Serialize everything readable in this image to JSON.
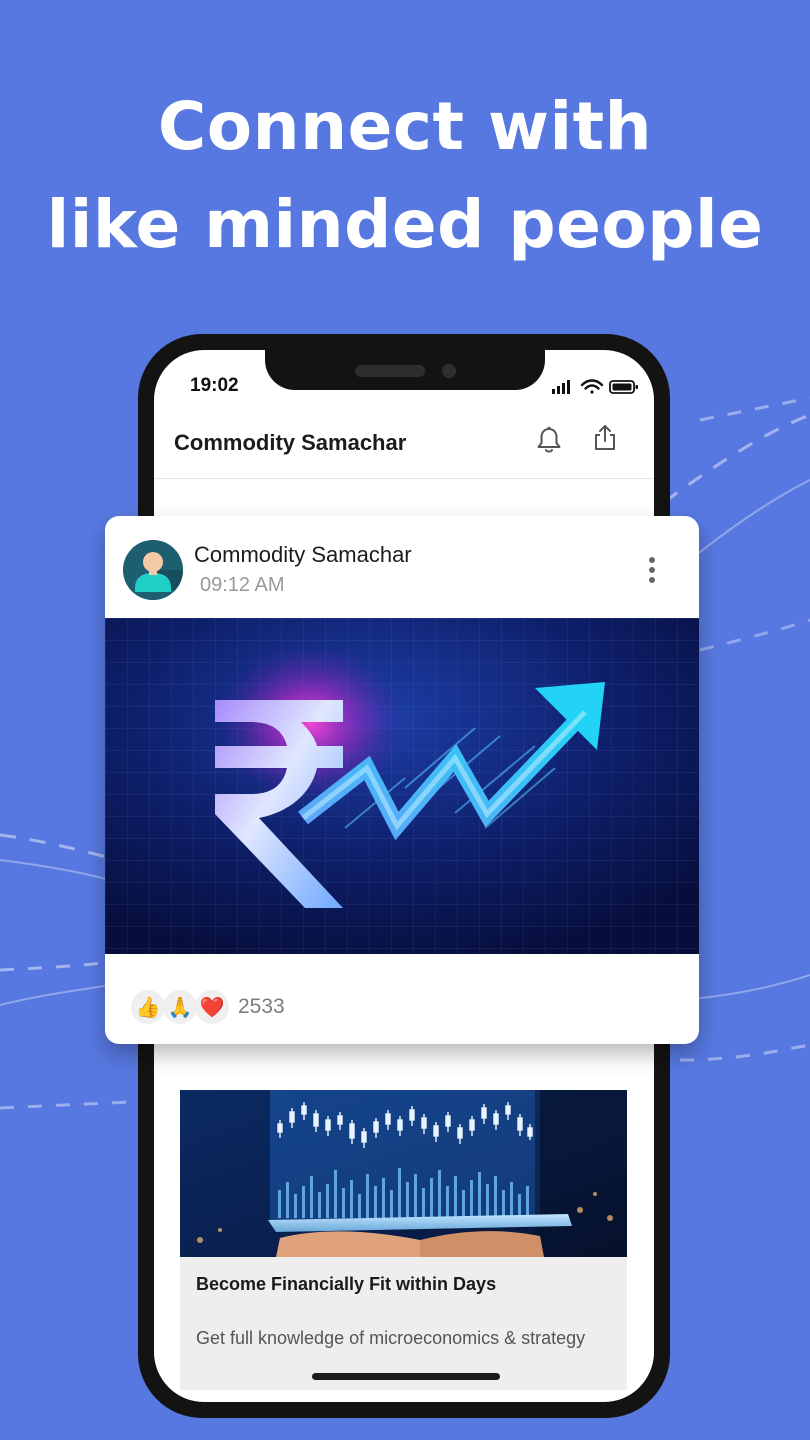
{
  "headline": {
    "line1": "Connect with",
    "line2": "like minded people"
  },
  "status_bar": {
    "time": "19:02",
    "icons": [
      "signal-icon",
      "wifi-icon",
      "battery-icon"
    ]
  },
  "app_bar": {
    "title": "Commodity Samachar",
    "icons": [
      "bell-icon",
      "share-icon"
    ]
  },
  "post": {
    "author": "Commodity Samachar",
    "time": "09:12 AM",
    "image": "rupee-growth-arrow",
    "reactions": [
      "👍",
      "🙏",
      "❤️"
    ],
    "reaction_count": "2533"
  },
  "feed_item": {
    "image": "stock-candlestick-chart-on-tablet",
    "title": "Become Financially Fit within Days",
    "description": "Get full knowledge of microeconomics & strategy"
  },
  "colors": {
    "background": "#5778e0",
    "phone_frame": "#131313",
    "accent_cyan": "#22d3f5",
    "accent_magenta": "#ff2fd0"
  }
}
